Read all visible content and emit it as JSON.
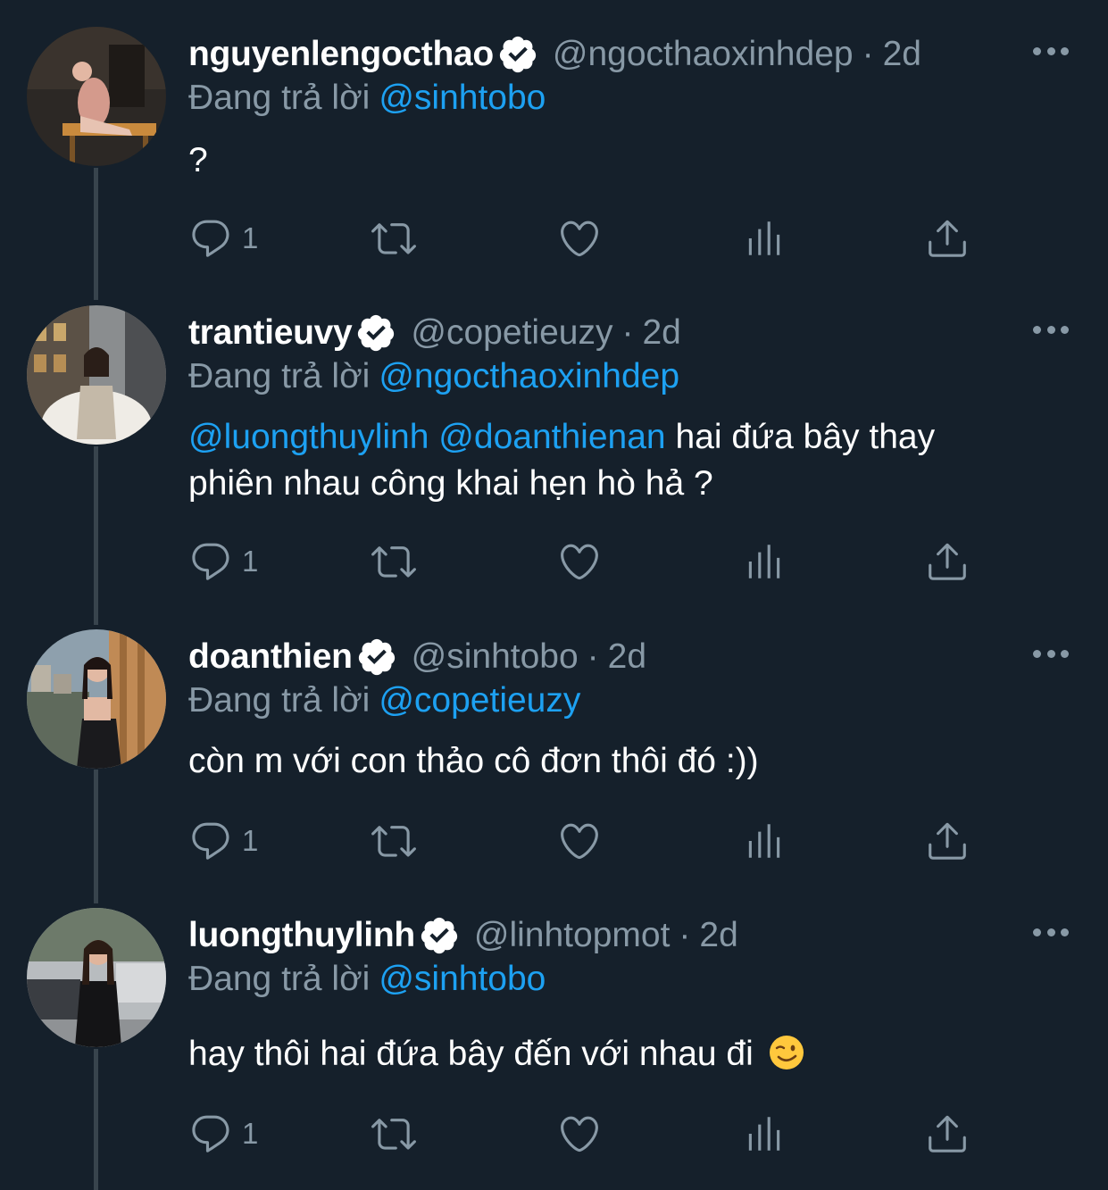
{
  "colors": {
    "background": "#15202b",
    "text": "#ffffff",
    "muted": "#8899a6",
    "link": "#1da1f2",
    "thread_line": "#38444d",
    "verified_badge": "#ffffff"
  },
  "reply_prefix": "Đang trả lời",
  "tweets": [
    {
      "name": "nguyenlengocthao",
      "handle": "@ngocthaoxinhdep",
      "separator": "·",
      "time": "2d",
      "reply_to": "@sinhtobo",
      "text": "?",
      "reply_count": "1",
      "avatar_icon": "avatar-photo"
    },
    {
      "name": "trantieuvy",
      "handle": "@copetieuzy",
      "separator": "·",
      "time": "2d",
      "reply_to": "@ngocthaoxinhdep",
      "mention_1": "@luongthuylinh",
      "mention_2": "@doanthienan",
      "text_line_1_rest": "hai đứa bây thay",
      "text_line_2": "phiên nhau công khai hẹn hò hả ?",
      "reply_count": "1",
      "avatar_icon": "avatar-photo"
    },
    {
      "name": "doanthien",
      "handle": "@sinhtobo",
      "separator": "·",
      "time": "2d",
      "reply_to": "@copetieuzy",
      "text": "còn m với con thảo cô đơn thôi đó :))",
      "reply_count": "1",
      "avatar_icon": "avatar-photo"
    },
    {
      "name": "luongthuylinh",
      "handle": "@linhtopmot",
      "separator": "·",
      "time": "2d",
      "reply_to": "@sinhtobo",
      "text": "hay thôi hai đứa bây đến với nhau đi",
      "emoji": "winking-face-emoji",
      "reply_count": "1",
      "avatar_icon": "avatar-photo"
    }
  ],
  "action_icons": [
    "reply-icon",
    "retweet-icon",
    "like-icon",
    "analytics-icon",
    "share-icon"
  ]
}
